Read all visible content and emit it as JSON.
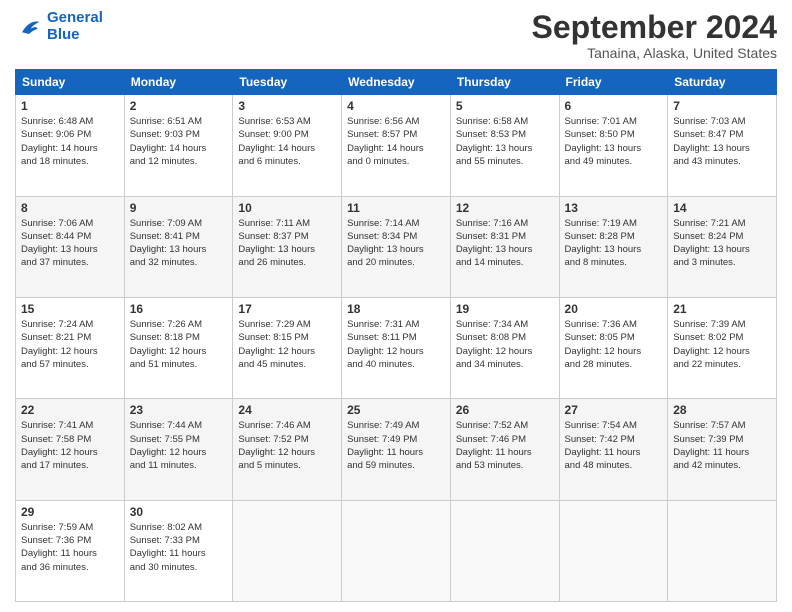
{
  "header": {
    "logo_line1": "General",
    "logo_line2": "Blue",
    "title": "September 2024",
    "location": "Tanaina, Alaska, United States"
  },
  "days_of_week": [
    "Sunday",
    "Monday",
    "Tuesday",
    "Wednesday",
    "Thursday",
    "Friday",
    "Saturday"
  ],
  "weeks": [
    [
      {
        "day": "1",
        "info": "Sunrise: 6:48 AM\nSunset: 9:06 PM\nDaylight: 14 hours\nand 18 minutes."
      },
      {
        "day": "2",
        "info": "Sunrise: 6:51 AM\nSunset: 9:03 PM\nDaylight: 14 hours\nand 12 minutes."
      },
      {
        "day": "3",
        "info": "Sunrise: 6:53 AM\nSunset: 9:00 PM\nDaylight: 14 hours\nand 6 minutes."
      },
      {
        "day": "4",
        "info": "Sunrise: 6:56 AM\nSunset: 8:57 PM\nDaylight: 14 hours\nand 0 minutes."
      },
      {
        "day": "5",
        "info": "Sunrise: 6:58 AM\nSunset: 8:53 PM\nDaylight: 13 hours\nand 55 minutes."
      },
      {
        "day": "6",
        "info": "Sunrise: 7:01 AM\nSunset: 8:50 PM\nDaylight: 13 hours\nand 49 minutes."
      },
      {
        "day": "7",
        "info": "Sunrise: 7:03 AM\nSunset: 8:47 PM\nDaylight: 13 hours\nand 43 minutes."
      }
    ],
    [
      {
        "day": "8",
        "info": "Sunrise: 7:06 AM\nSunset: 8:44 PM\nDaylight: 13 hours\nand 37 minutes."
      },
      {
        "day": "9",
        "info": "Sunrise: 7:09 AM\nSunset: 8:41 PM\nDaylight: 13 hours\nand 32 minutes."
      },
      {
        "day": "10",
        "info": "Sunrise: 7:11 AM\nSunset: 8:37 PM\nDaylight: 13 hours\nand 26 minutes."
      },
      {
        "day": "11",
        "info": "Sunrise: 7:14 AM\nSunset: 8:34 PM\nDaylight: 13 hours\nand 20 minutes."
      },
      {
        "day": "12",
        "info": "Sunrise: 7:16 AM\nSunset: 8:31 PM\nDaylight: 13 hours\nand 14 minutes."
      },
      {
        "day": "13",
        "info": "Sunrise: 7:19 AM\nSunset: 8:28 PM\nDaylight: 13 hours\nand 8 minutes."
      },
      {
        "day": "14",
        "info": "Sunrise: 7:21 AM\nSunset: 8:24 PM\nDaylight: 13 hours\nand 3 minutes."
      }
    ],
    [
      {
        "day": "15",
        "info": "Sunrise: 7:24 AM\nSunset: 8:21 PM\nDaylight: 12 hours\nand 57 minutes."
      },
      {
        "day": "16",
        "info": "Sunrise: 7:26 AM\nSunset: 8:18 PM\nDaylight: 12 hours\nand 51 minutes."
      },
      {
        "day": "17",
        "info": "Sunrise: 7:29 AM\nSunset: 8:15 PM\nDaylight: 12 hours\nand 45 minutes."
      },
      {
        "day": "18",
        "info": "Sunrise: 7:31 AM\nSunset: 8:11 PM\nDaylight: 12 hours\nand 40 minutes."
      },
      {
        "day": "19",
        "info": "Sunrise: 7:34 AM\nSunset: 8:08 PM\nDaylight: 12 hours\nand 34 minutes."
      },
      {
        "day": "20",
        "info": "Sunrise: 7:36 AM\nSunset: 8:05 PM\nDaylight: 12 hours\nand 28 minutes."
      },
      {
        "day": "21",
        "info": "Sunrise: 7:39 AM\nSunset: 8:02 PM\nDaylight: 12 hours\nand 22 minutes."
      }
    ],
    [
      {
        "day": "22",
        "info": "Sunrise: 7:41 AM\nSunset: 7:58 PM\nDaylight: 12 hours\nand 17 minutes."
      },
      {
        "day": "23",
        "info": "Sunrise: 7:44 AM\nSunset: 7:55 PM\nDaylight: 12 hours\nand 11 minutes."
      },
      {
        "day": "24",
        "info": "Sunrise: 7:46 AM\nSunset: 7:52 PM\nDaylight: 12 hours\nand 5 minutes."
      },
      {
        "day": "25",
        "info": "Sunrise: 7:49 AM\nSunset: 7:49 PM\nDaylight: 11 hours\nand 59 minutes."
      },
      {
        "day": "26",
        "info": "Sunrise: 7:52 AM\nSunset: 7:46 PM\nDaylight: 11 hours\nand 53 minutes."
      },
      {
        "day": "27",
        "info": "Sunrise: 7:54 AM\nSunset: 7:42 PM\nDaylight: 11 hours\nand 48 minutes."
      },
      {
        "day": "28",
        "info": "Sunrise: 7:57 AM\nSunset: 7:39 PM\nDaylight: 11 hours\nand 42 minutes."
      }
    ],
    [
      {
        "day": "29",
        "info": "Sunrise: 7:59 AM\nSunset: 7:36 PM\nDaylight: 11 hours\nand 36 minutes."
      },
      {
        "day": "30",
        "info": "Sunrise: 8:02 AM\nSunset: 7:33 PM\nDaylight: 11 hours\nand 30 minutes."
      },
      {
        "day": "",
        "info": ""
      },
      {
        "day": "",
        "info": ""
      },
      {
        "day": "",
        "info": ""
      },
      {
        "day": "",
        "info": ""
      },
      {
        "day": "",
        "info": ""
      }
    ]
  ]
}
